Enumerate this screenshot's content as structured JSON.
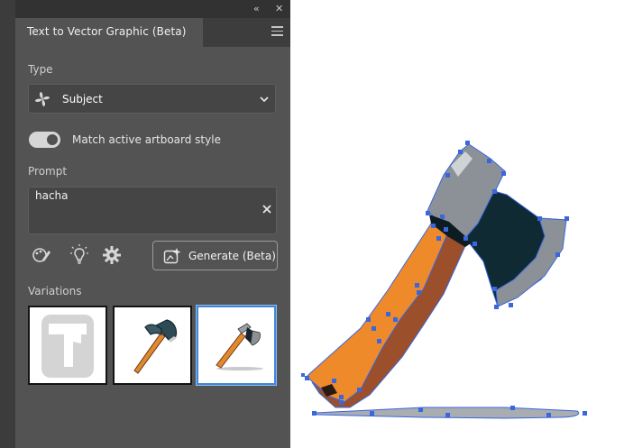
{
  "panel": {
    "tab_title": "Text to Vector Graphic (Beta)",
    "collapse_glyph": "«",
    "close_glyph": "✕",
    "type_label": "Type",
    "type_value": "Subject",
    "type_icon": "subject-pinwheel-icon",
    "toggle_label": "Match active artboard style",
    "toggle_on": true,
    "prompt_label": "Prompt",
    "prompt_value": "hacha",
    "generate_label": "Generate (Beta)",
    "variations_label": "Variations",
    "variations": [
      {
        "name": "variation-1",
        "selected": false
      },
      {
        "name": "variation-2",
        "selected": false
      },
      {
        "name": "variation-3",
        "selected": true
      }
    ]
  },
  "colors": {
    "panel_bg": "#535353",
    "field_bg": "#454545",
    "selection_blue": "#3f86d9",
    "axe_orange": "#e8892a",
    "axe_brown": "#9b4f2a",
    "axe_steel": "#8b9196",
    "axe_dark": "#14262e",
    "anchor_blue": "#3a66e0"
  }
}
